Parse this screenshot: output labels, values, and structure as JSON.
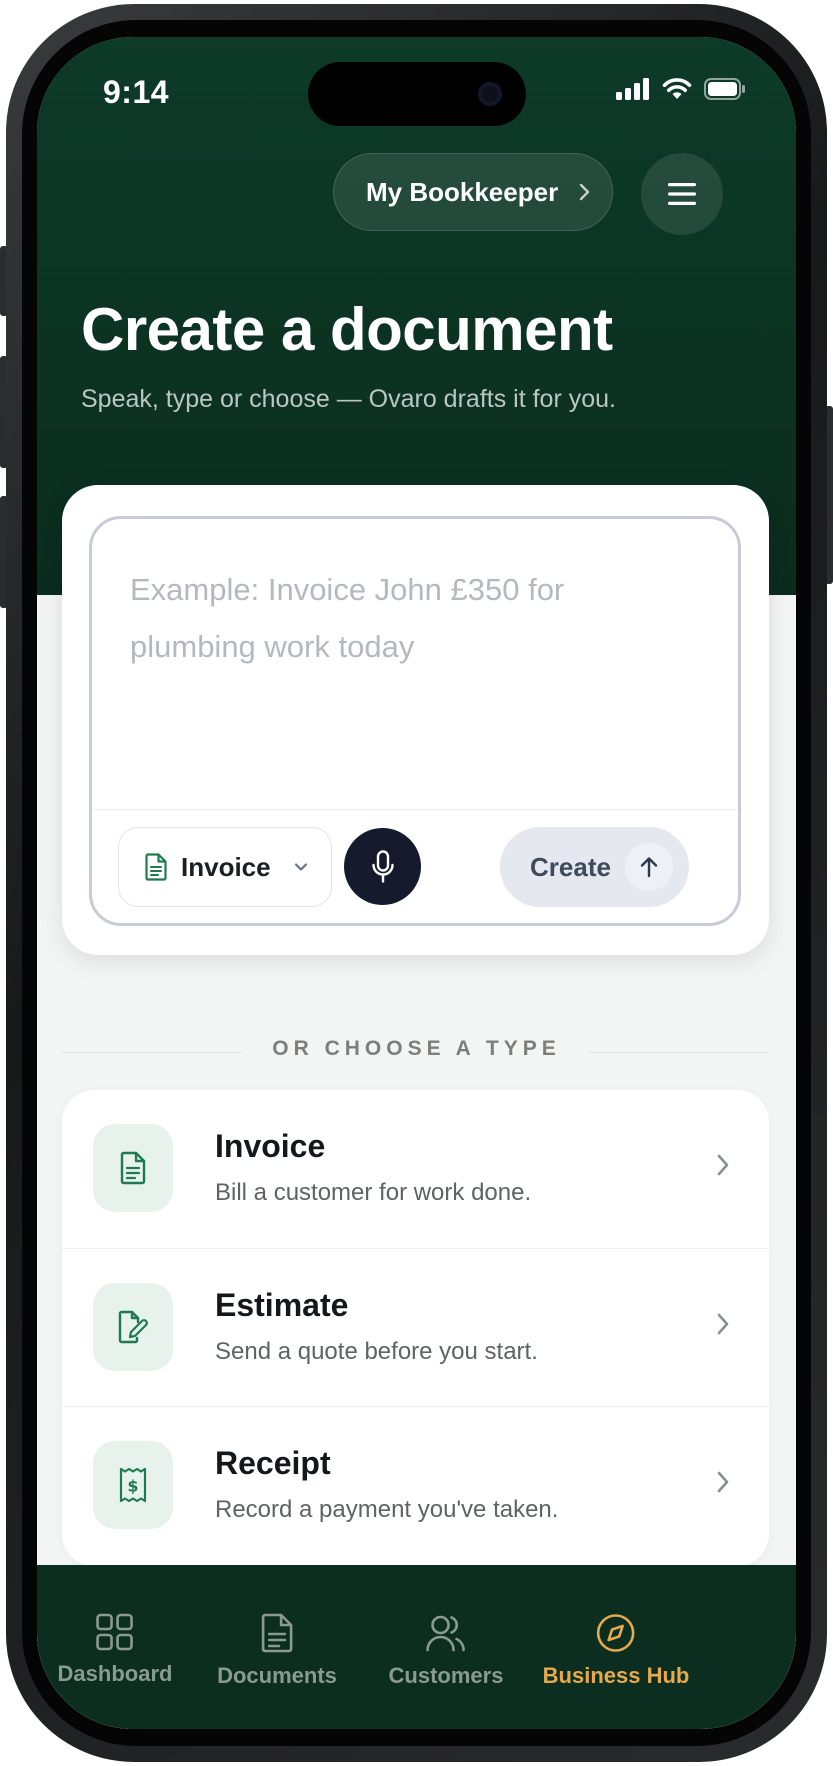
{
  "status_bar": {
    "time": "9:14"
  },
  "header": {
    "bookkeeper_label": "My Bookkeeper",
    "title": "Create a document",
    "subtitle": "Speak, type or choose — Ovaro drafts it for you."
  },
  "composer": {
    "placeholder": "Example: Invoice John £350 for plumbing work today",
    "type_select_value": "Invoice",
    "create_label": "Create"
  },
  "choose_label": "OR CHOOSE A TYPE",
  "document_types": [
    {
      "name": "Invoice",
      "description": "Bill a customer for work done.",
      "icon": "document-icon"
    },
    {
      "name": "Estimate",
      "description": "Send a quote before you start.",
      "icon": "document-edit-icon"
    },
    {
      "name": "Receipt",
      "description": "Record a payment you've taken.",
      "icon": "receipt-icon"
    }
  ],
  "nav": [
    {
      "label": "Dashboard",
      "icon": "grid-icon",
      "active": false
    },
    {
      "label": "Documents",
      "icon": "document-icon",
      "active": false
    },
    {
      "label": "Customers",
      "icon": "users-icon",
      "active": false
    },
    {
      "label": "Business Hub",
      "icon": "compass-icon",
      "active": true
    }
  ],
  "colors": {
    "hero": "#0c3322",
    "accent_green": "#1f7a4f",
    "active_nav": "#e8a94c",
    "mic_button": "#151a2d"
  }
}
